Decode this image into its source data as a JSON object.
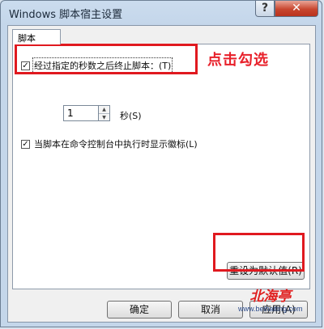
{
  "window": {
    "title": "Windows 脚本宿主设置",
    "help_glyph": "?",
    "close_glyph": "✕"
  },
  "tab": {
    "label": "脚本"
  },
  "options": {
    "stop_script": {
      "checked": true,
      "check_glyph": "✓",
      "label": "经过指定的秒数之后终止脚本：(T)"
    },
    "seconds": {
      "value": "1",
      "up_glyph": "▲",
      "down_glyph": "▼",
      "unit_label": "秒(S)"
    },
    "show_logo": {
      "checked": true,
      "check_glyph": "✓",
      "label": "当脚本在命令控制台中执行时显示徽标(L)"
    }
  },
  "buttons": {
    "reset_defaults": "重设为默认值(R)",
    "ok": "确定",
    "cancel": "取消",
    "apply": "应用(A)"
  },
  "annotation": {
    "text": "点击勾选",
    "color": "#e8202a"
  },
  "watermark": {
    "text": "北海亭",
    "url": "www.beihaiting.com"
  }
}
